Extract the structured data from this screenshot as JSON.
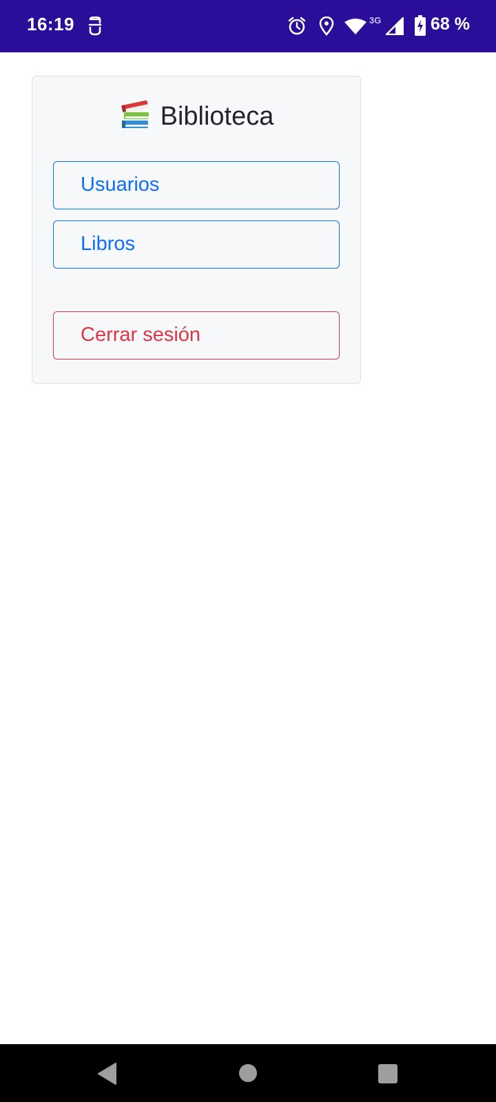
{
  "status_bar": {
    "time": "16:19",
    "network_label": "3G",
    "battery_percent": "68 %",
    "icons": [
      "notification-icon",
      "alarm-icon",
      "location-icon",
      "wifi-icon",
      "signal-icon",
      "battery-charging-icon"
    ]
  },
  "card": {
    "title_icon": "books-icon",
    "title": "Biblioteca",
    "buttons": [
      {
        "label": "Usuarios",
        "style": "primary"
      },
      {
        "label": "Libros",
        "style": "primary"
      },
      {
        "label": "Cerrar sesión",
        "style": "danger"
      }
    ]
  },
  "nav_bar": {
    "icons": [
      "back-icon",
      "home-icon",
      "recents-icon"
    ]
  },
  "colors": {
    "status_bar_bg": "#2a0e9a",
    "primary": "#0d6efd",
    "danger": "#dc3545",
    "card_bg": "#f7f8fa",
    "nav_bar_bg": "#000000"
  }
}
